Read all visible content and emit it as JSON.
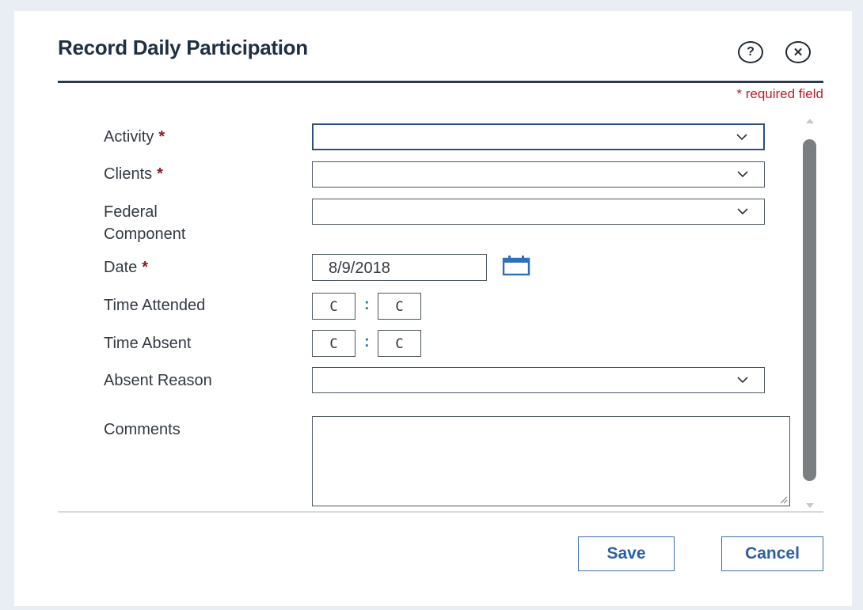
{
  "dialog": {
    "title": "Record Daily Participation",
    "help_icon": "?",
    "close_icon": "✕",
    "required_note": "* required field"
  },
  "form": {
    "activity": {
      "label": "Activity",
      "required": "*",
      "value": ""
    },
    "clients": {
      "label": "Clients",
      "required": "*",
      "value": ""
    },
    "federal_component": {
      "label_line1": "Federal",
      "label_line2": "Component",
      "value": ""
    },
    "date": {
      "label": "Date",
      "required": "*",
      "value": "8/9/2018"
    },
    "time_attended": {
      "label": "Time Attended",
      "hours": "C",
      "separator": ":",
      "minutes": "C"
    },
    "time_absent": {
      "label": "Time Absent",
      "hours": "C",
      "separator": ":",
      "minutes": "C"
    },
    "absent_reason": {
      "label": "Absent Reason",
      "value": ""
    },
    "comments": {
      "label": "Comments",
      "value": ""
    }
  },
  "footer": {
    "save_label": "Save",
    "cancel_label": "Cancel"
  },
  "colors": {
    "title": "#1f3044",
    "required": "#b51f2a",
    "button_text": "#2d5fa3",
    "calendar_icon": "#2e6fbd"
  },
  "icons": {
    "help": "help-icon",
    "close": "close-icon",
    "dropdown": "chevron-down-icon",
    "calendar": "calendar-icon"
  }
}
